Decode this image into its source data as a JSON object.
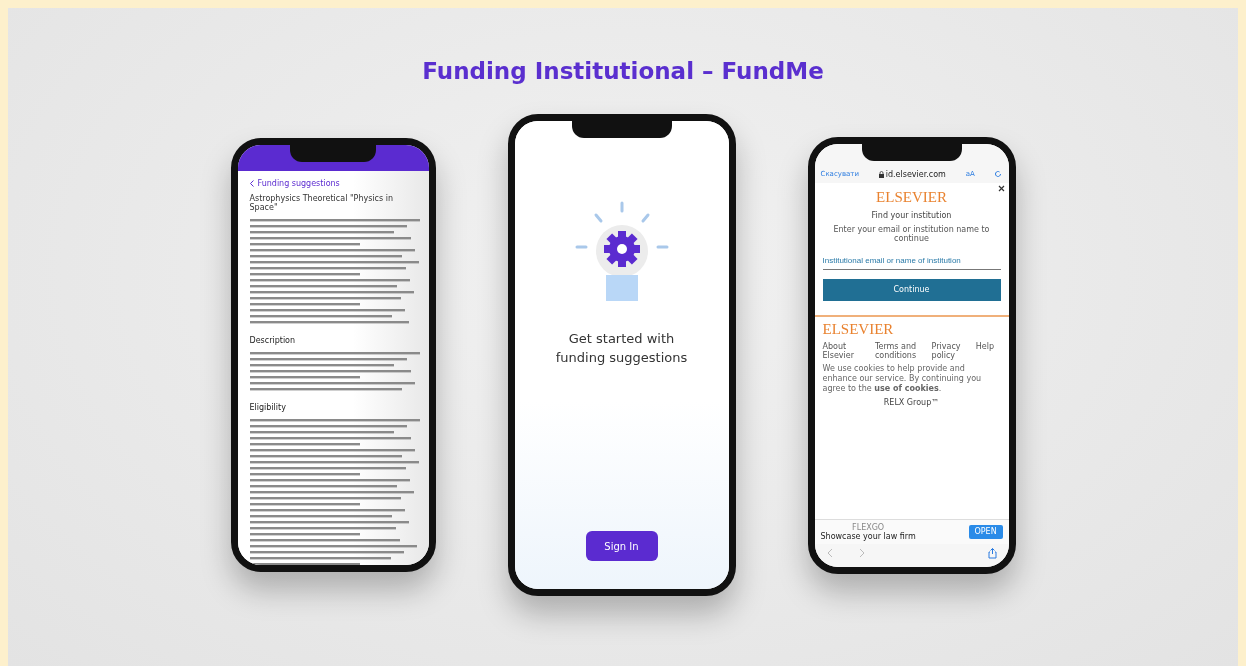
{
  "title": "Funding Institutional – FundMe",
  "details_phone": {
    "back_link": "Funding suggestions",
    "heading": "Astrophysics Theoretical \"Physics in Space\"",
    "sections": [
      {
        "heading": "Description"
      },
      {
        "heading": "Eligibility"
      }
    ]
  },
  "start_phone": {
    "message": "Get started with funding suggestions",
    "button": "Sign In"
  },
  "browser_phone": {
    "cancel": "Скасувати",
    "url": "id.elsevier.com",
    "text_size": "aA",
    "logo": "ELSEVIER",
    "heading": "Find your institution",
    "subheading": "Enter your email or institution name to continue",
    "field": {
      "placeholder": "Institutional email or name of institution"
    },
    "button": "Continue",
    "footer_logo": "ELSEVIER",
    "footer_links": [
      "About Elsevier",
      "Terms and conditions",
      "Privacy policy",
      "Help"
    ],
    "cookie_notice": "We use cookies to help provide and enhance our service. By continuing you agree to the **use of cookies**.",
    "group_logo": "RELX Group™",
    "ad": {
      "label": "FLEXGO",
      "text": "Showcase your law firm",
      "button": "OPEN"
    }
  }
}
